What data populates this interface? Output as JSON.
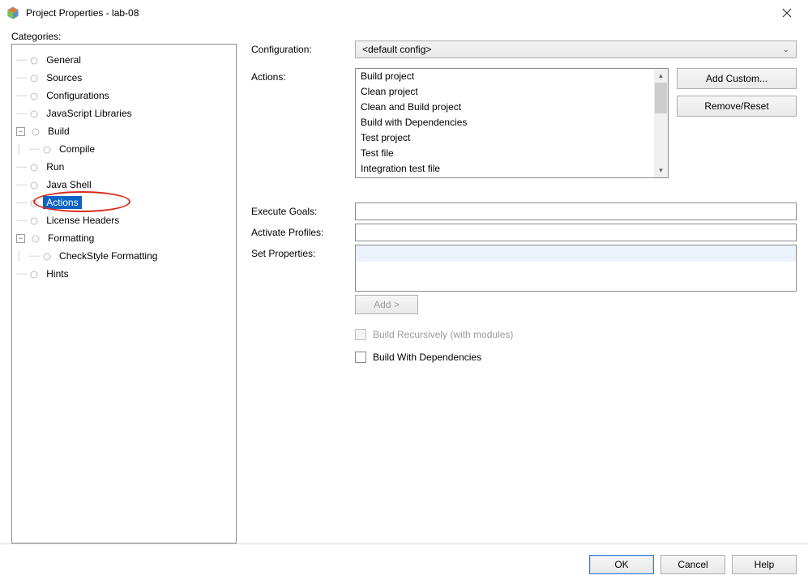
{
  "title": "Project Properties - lab-08",
  "categories_label": "Categories:",
  "tree": {
    "general": "General",
    "sources": "Sources",
    "configurations": "Configurations",
    "jslibs": "JavaScript Libraries",
    "build": "Build",
    "compile": "Compile",
    "run": "Run",
    "javashell": "Java Shell",
    "actions": "Actions",
    "license": "License Headers",
    "formatting": "Formatting",
    "checkstyle": "CheckStyle Formatting",
    "hints": "Hints"
  },
  "labels": {
    "configuration": "Configuration:",
    "actions": "Actions:",
    "execute_goals": "Execute Goals:",
    "activate_profiles": "Activate Profiles:",
    "set_properties": "Set Properties:",
    "add": "Add >",
    "build_recursively": "Build Recursively (with modules)",
    "build_with_deps": "Build With Dependencies"
  },
  "config_value": "<default config>",
  "actions_list": [
    "Build project",
    "Clean project",
    "Clean and Build project",
    "Build with Dependencies",
    "Test project",
    "Test file",
    "Integration test file"
  ],
  "side_buttons": {
    "add_custom": "Add Custom...",
    "remove_reset": "Remove/Reset"
  },
  "footer": {
    "ok": "OK",
    "cancel": "Cancel",
    "help": "Help"
  }
}
